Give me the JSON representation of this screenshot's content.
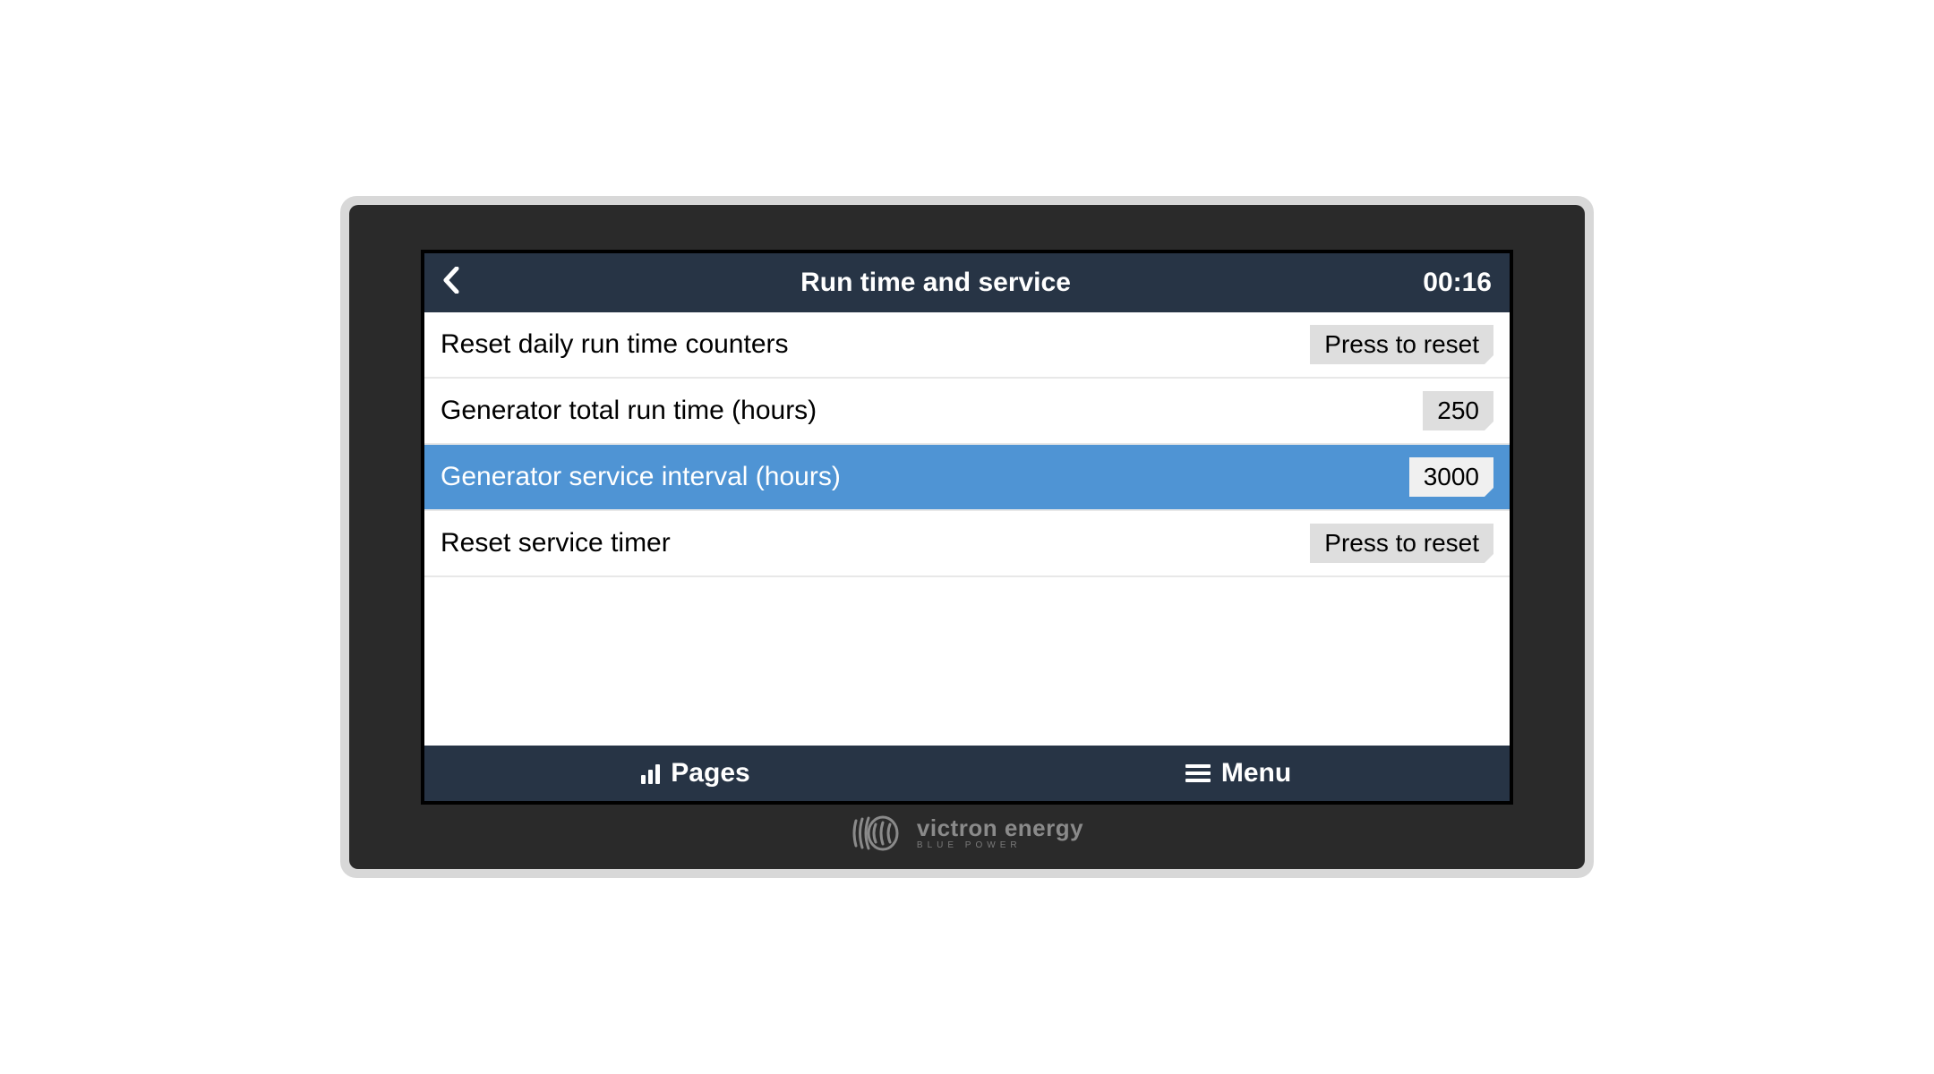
{
  "header": {
    "title": "Run time and service",
    "clock": "00:16"
  },
  "rows": [
    {
      "label": "Reset daily run time counters",
      "value": "Press to reset",
      "selected": false
    },
    {
      "label": "Generator total run time (hours)",
      "value": "250",
      "selected": false
    },
    {
      "label": "Generator service interval (hours)",
      "value": "3000",
      "selected": true
    },
    {
      "label": "Reset service timer",
      "value": "Press to reset",
      "selected": false
    }
  ],
  "footer": {
    "pages_label": "Pages",
    "menu_label": "Menu"
  },
  "brand": {
    "name": "victron energy",
    "tagline": "BLUE POWER"
  }
}
